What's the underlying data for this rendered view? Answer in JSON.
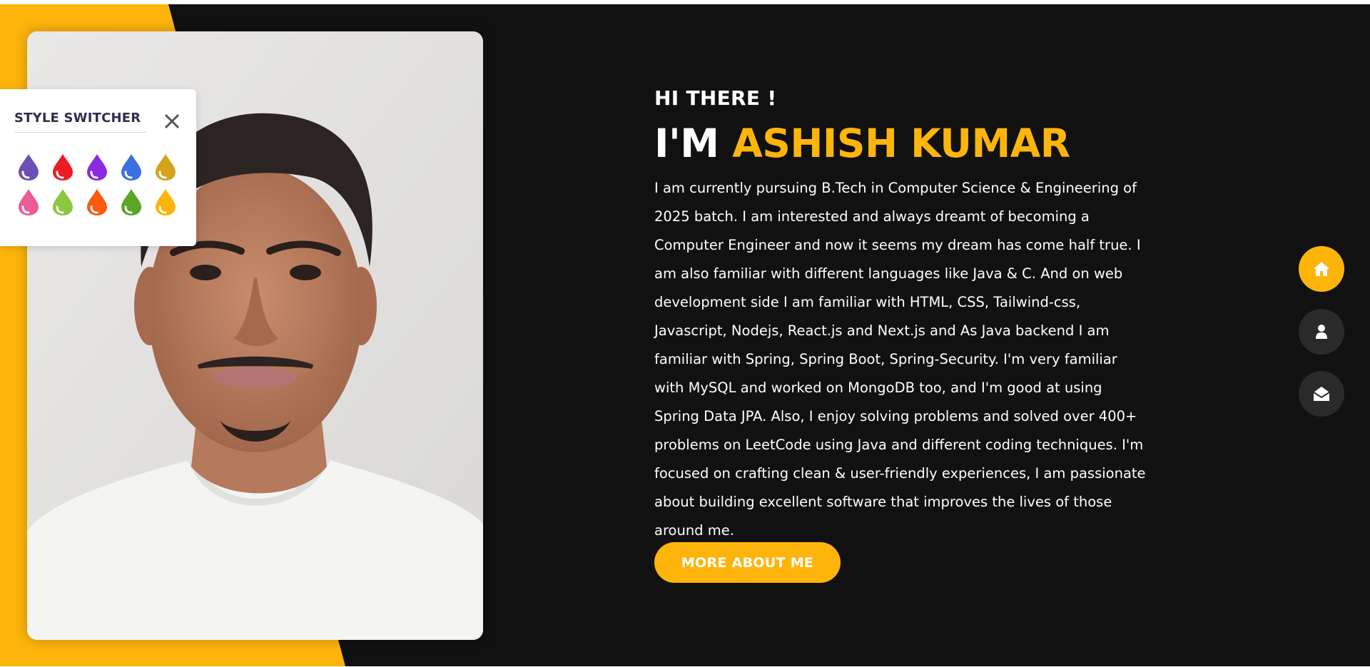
{
  "colors": {
    "accent": "#fdb50c",
    "background": "#111111",
    "text": "#ffffff",
    "nav_inactive": "#2a2a2a"
  },
  "style_switcher": {
    "title": "STYLE SWITCHER",
    "colors": [
      "#6e4fb3",
      "#ec1c24",
      "#8a2be2",
      "#3d6fe0",
      "#d6a21b",
      "#ec5b97",
      "#8dc63f",
      "#fa5b0f",
      "#5aa625",
      "#fdb50c"
    ]
  },
  "hero": {
    "greeting": "HI THERE !",
    "name_prefix": "I'M ",
    "name": "ASHISH KUMAR",
    "bio": "I am currently pursuing B.Tech in Computer Science & Engineering of 2025 batch. I am interested and always dreamt of becoming a Computer Engineer and now it seems my dream has come half true. I am also familiar with different languages like Java & C. And on web development side I am familiar with HTML, CSS, Tailwind-css, Javascript, Nodejs, React.js and Next.js and As Java backend I am familiar with Spring, Spring Boot, Spring-Security. I'm very familiar with MySQL and worked on MongoDB too, and I'm good at using Spring Data JPA. Also, I enjoy solving problems and solved over 400+ problems on LeetCode using Java and different coding techniques. I'm focused on crafting clean & user-friendly experiences, I am passionate about building excellent software that improves the lives of those around me.",
    "cta_label": "MORE ABOUT ME"
  },
  "nav": {
    "icons": [
      "home-icon",
      "user-icon",
      "envelope-open-icon"
    ],
    "active": "home"
  }
}
